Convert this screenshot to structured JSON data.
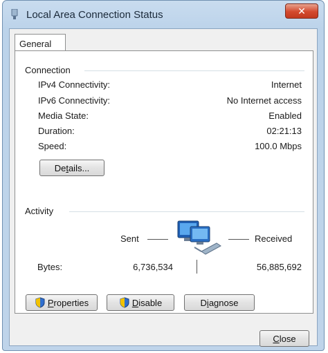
{
  "window": {
    "title": "Local Area Connection Status",
    "close_glyph": "✕"
  },
  "tabs": [
    {
      "label": "General"
    }
  ],
  "connection": {
    "heading": "Connection",
    "rows": [
      {
        "label": "IPv4 Connectivity:",
        "value": "Internet"
      },
      {
        "label": "IPv6 Connectivity:",
        "value": "No Internet access"
      },
      {
        "label": "Media State:",
        "value": "Enabled"
      },
      {
        "label": "Duration:",
        "value": "02:21:13"
      },
      {
        "label": "Speed:",
        "value": "100.0 Mbps"
      }
    ],
    "details_button": {
      "pre": "De",
      "accel": "t",
      "post": "ails..."
    }
  },
  "activity": {
    "heading": "Activity",
    "sent_label": "Sent",
    "received_label": "Received",
    "bytes_label": "Bytes:",
    "bytes_sent": "6,736,534",
    "bytes_received": "56,885,692",
    "icon": "network-computers-icon"
  },
  "buttons": {
    "properties": {
      "accel": "P",
      "rest": "roperties",
      "icon": "uac-shield-icon"
    },
    "disable": {
      "accel": "D",
      "rest": "isable",
      "icon": "uac-shield-icon"
    },
    "diagnose": {
      "pre": "D",
      "accel": "i",
      "post": "agnose"
    },
    "close": {
      "accel": "C",
      "rest": "lose"
    }
  },
  "colors": {
    "frame": "#bfd4ea",
    "close_red": "#d3492e",
    "shield_blue": "#2f6fd0",
    "shield_yellow": "#f2c200"
  }
}
